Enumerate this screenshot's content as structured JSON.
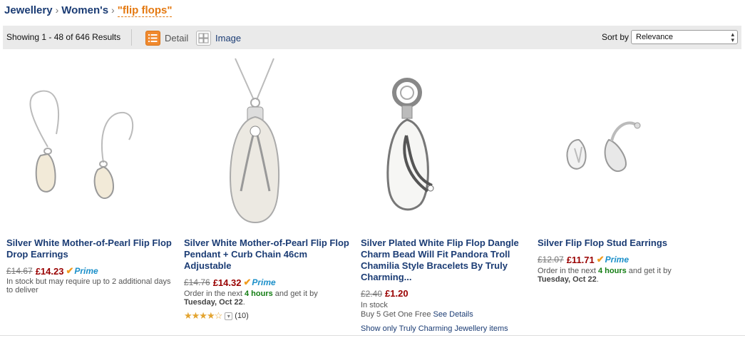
{
  "breadcrumb": {
    "items": [
      "Jewellery",
      "Women's"
    ],
    "separator": "›",
    "query": "\"flip flops\""
  },
  "toolbar": {
    "showing_prefix": "Showing ",
    "showing_range": "1 - 48",
    "showing_mid": " of ",
    "showing_total": "646",
    "showing_suffix": " Results",
    "view_detail": "Detail",
    "view_image": "Image",
    "sort_label": "Sort by",
    "sort_value": "Relevance",
    "accent_color": "#f0892e"
  },
  "products": [
    {
      "title": "Silver White Mother-of-Pearl Flip Flop Drop Earrings",
      "old_price": "£14.67",
      "new_price": "£14.23",
      "prime": "Prime",
      "availability": "In stock but may require up to 2 additional days to deliver"
    },
    {
      "title": "Silver White Mother-of-Pearl Flip Flop Pendant + Curb Chain 46cm Adjustable",
      "old_price": "£14.76",
      "new_price": "£14.32",
      "prime": "Prime",
      "order_prefix": "Order in the next ",
      "order_time": "4 hours",
      "order_suffix": " and get it by",
      "delivery_date": "Tuesday, Oct 22",
      "rating": 4,
      "review_count": "(10)"
    },
    {
      "title": "Silver Plated White Flip Flop Dangle Charm Bead Will Fit Pandora Troll Chamilia Style Bracelets By Truly Charming...",
      "old_price": "£2.40",
      "new_price": "£1.20",
      "availability": "In stock",
      "offer_text": "Buy 5 Get One Free",
      "offer_link": "See Details",
      "brand_link": "Show only Truly Charming Jewellery items"
    },
    {
      "title": "Silver Flip Flop Stud Earrings",
      "old_price": "£12.07",
      "new_price": "£11.71",
      "prime": "Prime",
      "order_prefix": "Order in the next ",
      "order_time": "4 hours",
      "order_suffix": " and get it by",
      "delivery_date": "Tuesday, Oct 22"
    }
  ]
}
